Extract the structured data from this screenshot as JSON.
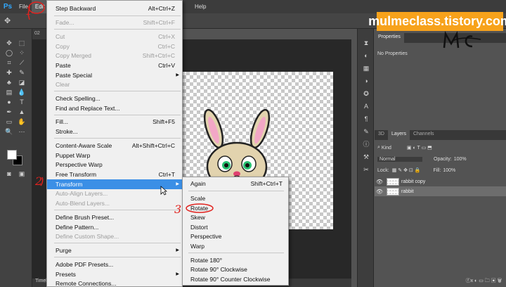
{
  "menubar": {
    "logo": "Ps",
    "items": [
      "File",
      "Edit",
      "Help"
    ]
  },
  "document": {
    "tab_label": "02",
    "status_label": "Timeli"
  },
  "edit_menu": {
    "items": [
      {
        "label": "Step Backward",
        "shortcut": "Alt+Ctrl+Z",
        "enabled": true
      },
      {
        "label": "Fade...",
        "shortcut": "Shift+Ctrl+F",
        "enabled": false
      },
      {
        "label": "Cut",
        "shortcut": "Ctrl+X",
        "enabled": false
      },
      {
        "label": "Copy",
        "shortcut": "Ctrl+C",
        "enabled": false
      },
      {
        "label": "Copy Merged",
        "shortcut": "Shift+Ctrl+C",
        "enabled": false
      },
      {
        "label": "Paste",
        "shortcut": "Ctrl+V",
        "enabled": true
      },
      {
        "label": "Paste Special",
        "shortcut": "",
        "enabled": true,
        "submenu": true
      },
      {
        "label": "Clear",
        "shortcut": "",
        "enabled": false
      },
      {
        "label": "Check Spelling...",
        "shortcut": "",
        "enabled": true
      },
      {
        "label": "Find and Replace Text...",
        "shortcut": "",
        "enabled": true
      },
      {
        "label": "Fill...",
        "shortcut": "Shift+F5",
        "enabled": true
      },
      {
        "label": "Stroke...",
        "shortcut": "",
        "enabled": true
      },
      {
        "label": "Content-Aware Scale",
        "shortcut": "Alt+Shift+Ctrl+C",
        "enabled": true
      },
      {
        "label": "Puppet Warp",
        "shortcut": "",
        "enabled": true
      },
      {
        "label": "Perspective Warp",
        "shortcut": "",
        "enabled": true
      },
      {
        "label": "Free Transform",
        "shortcut": "Ctrl+T",
        "enabled": true
      },
      {
        "label": "Transform",
        "shortcut": "",
        "enabled": true,
        "submenu": true,
        "highlighted": true
      },
      {
        "label": "Auto-Align Layers...",
        "shortcut": "",
        "enabled": false
      },
      {
        "label": "Auto-Blend Layers...",
        "shortcut": "",
        "enabled": false
      },
      {
        "label": "Define Brush Preset...",
        "shortcut": "",
        "enabled": true
      },
      {
        "label": "Define Pattern...",
        "shortcut": "",
        "enabled": true
      },
      {
        "label": "Define Custom Shape...",
        "shortcut": "",
        "enabled": false
      },
      {
        "label": "Purge",
        "shortcut": "",
        "enabled": true,
        "submenu": true
      },
      {
        "label": "Adobe PDF Presets...",
        "shortcut": "",
        "enabled": true
      },
      {
        "label": "Presets",
        "shortcut": "",
        "enabled": true,
        "submenu": true
      },
      {
        "label": "Remote Connections...",
        "shortcut": "",
        "enabled": true
      }
    ]
  },
  "transform_submenu": {
    "items": [
      {
        "label": "Again",
        "shortcut": "Shift+Ctrl+T"
      },
      {
        "label": "Scale",
        "shortcut": ""
      },
      {
        "label": "Rotate",
        "shortcut": ""
      },
      {
        "label": "Skew",
        "shortcut": ""
      },
      {
        "label": "Distort",
        "shortcut": ""
      },
      {
        "label": "Perspective",
        "shortcut": ""
      },
      {
        "label": "Warp",
        "shortcut": ""
      },
      {
        "label": "Rotate 180°",
        "shortcut": ""
      },
      {
        "label": "Rotate 90° Clockwise",
        "shortcut": ""
      },
      {
        "label": "Rotate 90° Counter Clockwise",
        "shortcut": ""
      }
    ]
  },
  "panels": {
    "properties": {
      "tabs": [
        "Properties"
      ],
      "body": "No Properties"
    },
    "layers": {
      "tabs": [
        "3D",
        "Layers",
        "Channels"
      ],
      "filter_label": "Kind",
      "blend_mode": "Normal",
      "opacity_label": "Opacity:",
      "opacity_value": "100%",
      "lock_label": "Lock:",
      "fill_label": "Fill:",
      "fill_value": "100%",
      "layers": [
        {
          "name": "rabbit copy",
          "selected": false
        },
        {
          "name": "rabbit",
          "selected": true
        }
      ]
    }
  },
  "watermark": {
    "text": "mulmeclass.tistory.com",
    "mark": "Mc"
  },
  "annotations": [
    "1",
    "2",
    "3"
  ],
  "colors": {
    "highlight": "#3b8fe6",
    "annotation": "#e0221e",
    "watermark_bg": "#f7a21b"
  }
}
